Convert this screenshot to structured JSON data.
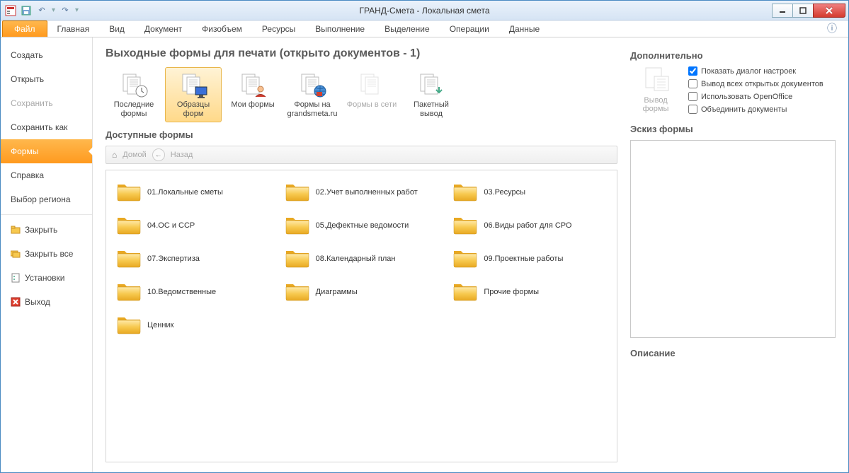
{
  "window": {
    "title": "ГРАНД-Смета - Локальная смета"
  },
  "ribbon": {
    "file": "Файл",
    "tabs": [
      "Главная",
      "Вид",
      "Документ",
      "Физобъем",
      "Ресурсы",
      "Выполнение",
      "Выделение",
      "Операции",
      "Данные"
    ]
  },
  "backstage": {
    "items": [
      {
        "label": "Создать",
        "type": "plain"
      },
      {
        "label": "Открыть",
        "type": "plain"
      },
      {
        "label": "Сохранить",
        "type": "disabled"
      },
      {
        "label": "Сохранить как",
        "type": "plain"
      },
      {
        "label": "Формы",
        "type": "active"
      },
      {
        "label": "Справка",
        "type": "plain"
      },
      {
        "label": "Выбор региона",
        "type": "plain"
      },
      {
        "label": "Закрыть",
        "type": "ico",
        "icon": "folder"
      },
      {
        "label": "Закрыть все",
        "type": "ico",
        "icon": "folders"
      },
      {
        "label": "Установки",
        "type": "ico",
        "icon": "gear"
      },
      {
        "label": "Выход",
        "type": "ico",
        "icon": "exit"
      }
    ]
  },
  "center": {
    "title": "Выходные формы для печати (открыто документов - 1)",
    "cards": [
      {
        "label": "Последние формы",
        "icon": "clock"
      },
      {
        "label": "Образцы форм",
        "icon": "monitor",
        "active": true
      },
      {
        "label": "Мои формы",
        "icon": "user"
      },
      {
        "label": "Формы на grandsmeta.ru",
        "icon": "globe"
      },
      {
        "label": "Формы в сети",
        "icon": "net",
        "disabled": true
      },
      {
        "label": "Пакетный вывод",
        "icon": "batch"
      }
    ],
    "available_title": "Доступные формы",
    "breadcrumb": {
      "home": "Домой",
      "back": "Назад"
    },
    "folders": [
      "01.Локальные сметы",
      "02.Учет выполненных работ",
      "03.Ресурсы",
      "04.ОС и ССР",
      "05.Дефектные ведомости",
      "06.Виды работ для СРО",
      "07.Экспертиза",
      "08.Календарный план",
      "09.Проектные работы",
      "10.Ведомственные",
      "Диаграммы",
      "Прочие формы",
      "Ценник"
    ]
  },
  "right": {
    "extra_title": "Дополнительно",
    "output_label": "Вывод формы",
    "checks": [
      {
        "label": "Показать диалог настроек",
        "checked": true
      },
      {
        "label": "Вывод всех открытых документов",
        "checked": false
      },
      {
        "label": "Использовать OpenOffice",
        "checked": false
      },
      {
        "label": "Объединить документы",
        "checked": false
      }
    ],
    "preview_title": "Эскиз формы",
    "desc_title": "Описание"
  }
}
